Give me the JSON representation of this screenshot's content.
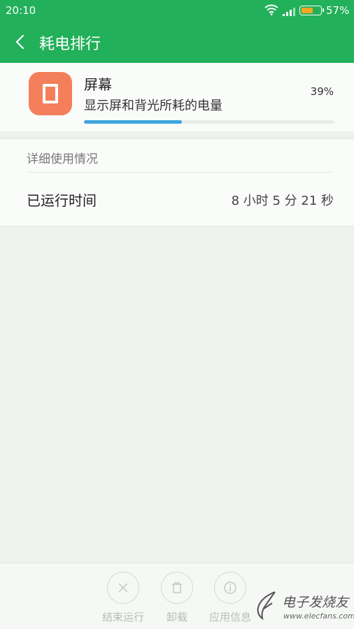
{
  "status_bar": {
    "time": "20:10",
    "battery_percent": "57%",
    "battery_level": 0.57,
    "battery_color": "#f5a623"
  },
  "header": {
    "title": "耗电排行",
    "back_icon": "chevron-left-icon",
    "background_color": "#22b05a"
  },
  "usage_item": {
    "name": "屏幕",
    "description": "显示屏和背光所耗的电量",
    "percent": "39%",
    "progress": 0.39,
    "icon": "screen-icon",
    "icon_color": "#f3805a",
    "progress_color": "#3fa5e0"
  },
  "detail": {
    "section_title": "详细使用情况",
    "rows": [
      {
        "label": "已运行时间",
        "value": "8 小时 5 分 21 秒"
      }
    ]
  },
  "actions": [
    {
      "label": "结束运行",
      "icon": "close-icon"
    },
    {
      "label": "卸载",
      "icon": "trash-icon"
    },
    {
      "label": "应用信息",
      "icon": "info-icon"
    }
  ],
  "watermark": {
    "text": "电子发烧友",
    "url": "www.elecfans.com"
  }
}
